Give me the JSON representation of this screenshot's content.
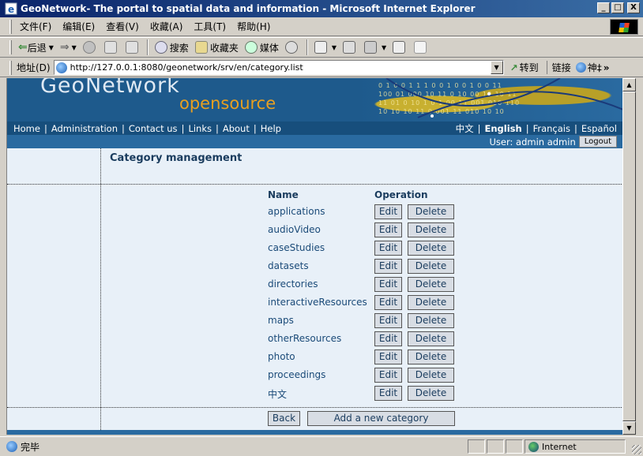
{
  "window": {
    "title": "GeoNetwork- The portal to spatial data and information - Microsoft Internet Explorer",
    "minimize": "_",
    "maximize": "□",
    "close": "X"
  },
  "menu": [
    "文件(F)",
    "编辑(E)",
    "查看(V)",
    "收藏(A)",
    "工具(T)",
    "帮助(H)"
  ],
  "toolbar": {
    "back": "后退",
    "search": "搜索",
    "favorites": "收藏夹",
    "media": "媒体"
  },
  "address": {
    "label": "地址(D)",
    "url": "http://127.0.0.1:8080/geonetwork/srv/en/category.list",
    "go": "转到",
    "links": "链接",
    "links_extra": "神‡",
    "more": "»"
  },
  "banner": {
    "logo_main": "GeoNetwork",
    "logo_sub": "opensource",
    "digits": [
      "0 1 0 0 1     1 1 0 0 1 0     0 1 0 0 11",
      "100  01 000 10 11 0 10 00 10 10 11",
      "11 01 0 10 1 0 1 00 11 001 010 110",
      "10 10 10 11 0 001 11 010 10 10"
    ]
  },
  "nav": {
    "links": [
      "Home",
      "Administration",
      "Contact us",
      "Links",
      "About",
      "Help"
    ],
    "languages": [
      "中文",
      "English",
      "Français",
      "Español"
    ],
    "current_language": "English"
  },
  "user": {
    "label": "User: admin admin",
    "logout": "Logout"
  },
  "page": {
    "title": "Category management",
    "col_name": "Name",
    "col_operation": "Operation",
    "edit_label": "Edit",
    "delete_label": "Delete",
    "categories": [
      "applications",
      "audioVideo",
      "caseStudies",
      "datasets",
      "directories",
      "interactiveResources",
      "maps",
      "otherResources",
      "photo",
      "proceedings",
      "中文"
    ],
    "back": "Back",
    "add": "Add a new category"
  },
  "status": {
    "text": "完毕",
    "zone": "Internet"
  }
}
